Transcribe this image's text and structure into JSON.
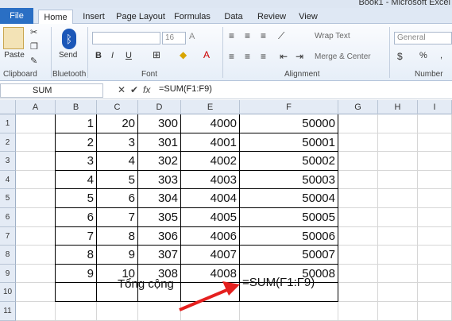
{
  "window": {
    "title": "Book1 - Microsoft Excel"
  },
  "ribbon_tabs": [
    "File",
    "Home",
    "Insert",
    "Page Layout",
    "Formulas",
    "Data",
    "Review",
    "View"
  ],
  "ribbon": {
    "clipboard": {
      "paste": "Paste",
      "label": "Clipboard"
    },
    "bluetooth": {
      "send": "Send",
      "label": "Bluetooth"
    },
    "font": {
      "size": "16",
      "bold": "B",
      "italic": "I",
      "underline": "U",
      "grow": "A",
      "label": "Font"
    },
    "alignment": {
      "wrap_text": "Wrap Text",
      "merge_center": "Merge & Center",
      "label": "Alignment"
    },
    "number": {
      "format": "General",
      "percent": "%",
      "comma": ",",
      "label": "Number"
    }
  },
  "formula_bar": {
    "name_box": "SUM",
    "cancel": "✕",
    "enter": "✔",
    "fx": "fx",
    "content": "=SUM(F1:F9)"
  },
  "columns": [
    "A",
    "B",
    "C",
    "D",
    "E",
    "F",
    "G",
    "H",
    "I"
  ],
  "rows": [
    "1",
    "2",
    "3",
    "4",
    "5",
    "6",
    "7",
    "8",
    "9",
    "10",
    "11"
  ],
  "table": [
    [
      "1",
      "20",
      "300",
      "4000",
      "50000"
    ],
    [
      "2",
      "3",
      "301",
      "4001",
      "50001"
    ],
    [
      "3",
      "4",
      "302",
      "4002",
      "50002"
    ],
    [
      "4",
      "5",
      "303",
      "4003",
      "50003"
    ],
    [
      "5",
      "6",
      "304",
      "4004",
      "50004"
    ],
    [
      "6",
      "7",
      "305",
      "4005",
      "50005"
    ],
    [
      "7",
      "8",
      "306",
      "4006",
      "50006"
    ],
    [
      "8",
      "9",
      "307",
      "4007",
      "50007"
    ],
    [
      "9",
      "10",
      "308",
      "4008",
      "50008"
    ]
  ],
  "total": {
    "label": "Tổng cộng",
    "formula": "=SUM(F1:F9)"
  },
  "colors": {
    "file_tab": "#2a6fc4",
    "arrow": "#e5201f"
  }
}
